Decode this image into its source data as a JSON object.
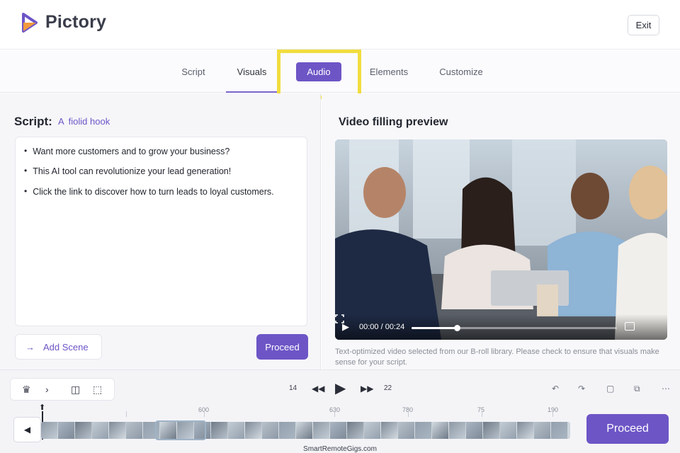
{
  "app": {
    "name": "Pictory",
    "exit_label": "Exit",
    "brand_color": "#6d55c6"
  },
  "tabs": [
    {
      "label": "Script",
      "active": false
    },
    {
      "label": "Visuals",
      "active": true
    },
    {
      "label": "Audio",
      "active": false,
      "highlighted": true
    },
    {
      "label": "Elements",
      "active": false
    },
    {
      "label": "Customize",
      "active": false
    }
  ],
  "script": {
    "title": "Script:",
    "hook_label": "fiolid hook",
    "hook_icon": "text-a-icon",
    "bullets": [
      "Want more customers and to grow your business?",
      "This AI tool can revolutionize your lead generation!",
      "Click the link to discover how to turn leads to loyal customers."
    ],
    "add_scene_label": "Add Scene",
    "proceed_label": "Proceed"
  },
  "preview": {
    "title": "Video filling preview",
    "time": "00:00 / 00:24",
    "progress": 0.22,
    "caption": "Text-optimized video selected from our B-roll library. Please check to ensure that visuals make sense for your script."
  },
  "timeline": {
    "left_num": "14",
    "right_num": "22",
    "ruler_labels": [
      "600",
      "630",
      "780",
      "75",
      "190"
    ],
    "proceed_label": "Proceed",
    "tools": [
      "ai-magic-icon",
      "chevron-right-icon",
      "split-icon",
      "select-icon"
    ],
    "edit_tools": [
      "undo-icon",
      "redo-icon",
      "copy-icon",
      "duplicate-icon",
      "more-icon"
    ]
  },
  "watermark": "SmartRemoteGigs.com"
}
